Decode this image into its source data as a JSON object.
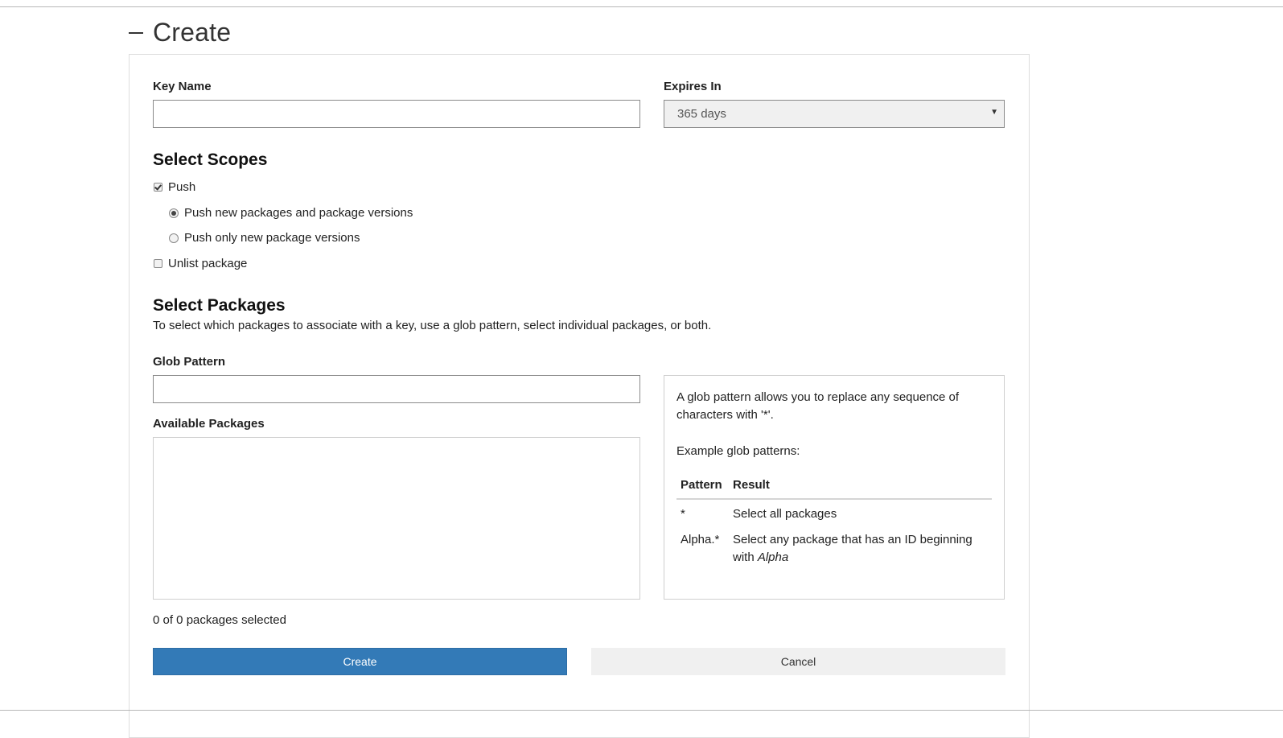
{
  "section": {
    "title": "Create",
    "collapse_icon": "minus-icon"
  },
  "key_name": {
    "label": "Key Name",
    "value": "",
    "placeholder": ""
  },
  "expires_in": {
    "label": "Expires In",
    "selected": "365 days"
  },
  "scopes": {
    "heading": "Select Scopes",
    "push_label": "Push",
    "push_checked": true,
    "radio_new": "Push new packages and package versions",
    "radio_versions": "Push only new package versions",
    "unlist_label": "Unlist package",
    "unlist_checked": false
  },
  "packages": {
    "heading": "Select Packages",
    "description": "To select which packages to associate with a key, use a glob pattern, select individual packages, or both.",
    "glob_label": "Glob Pattern",
    "glob_value": "",
    "available_label": "Available Packages",
    "count_text": "0 of 0 packages selected"
  },
  "help": {
    "intro": "A glob pattern allows you to replace any sequence of characters with '*'.",
    "examples_heading": "Example glob patterns:",
    "col_pattern": "Pattern",
    "col_result": "Result",
    "row1_pattern": "*",
    "row1_result": "Select all packages",
    "row2_pattern": "Alpha.*",
    "row2_result_prefix": "Select any package that has an ID beginning with ",
    "row2_result_em": "Alpha"
  },
  "buttons": {
    "create": "Create",
    "cancel": "Cancel"
  },
  "colors": {
    "primary": "#337ab7",
    "secondary": "#f0f0f0"
  }
}
